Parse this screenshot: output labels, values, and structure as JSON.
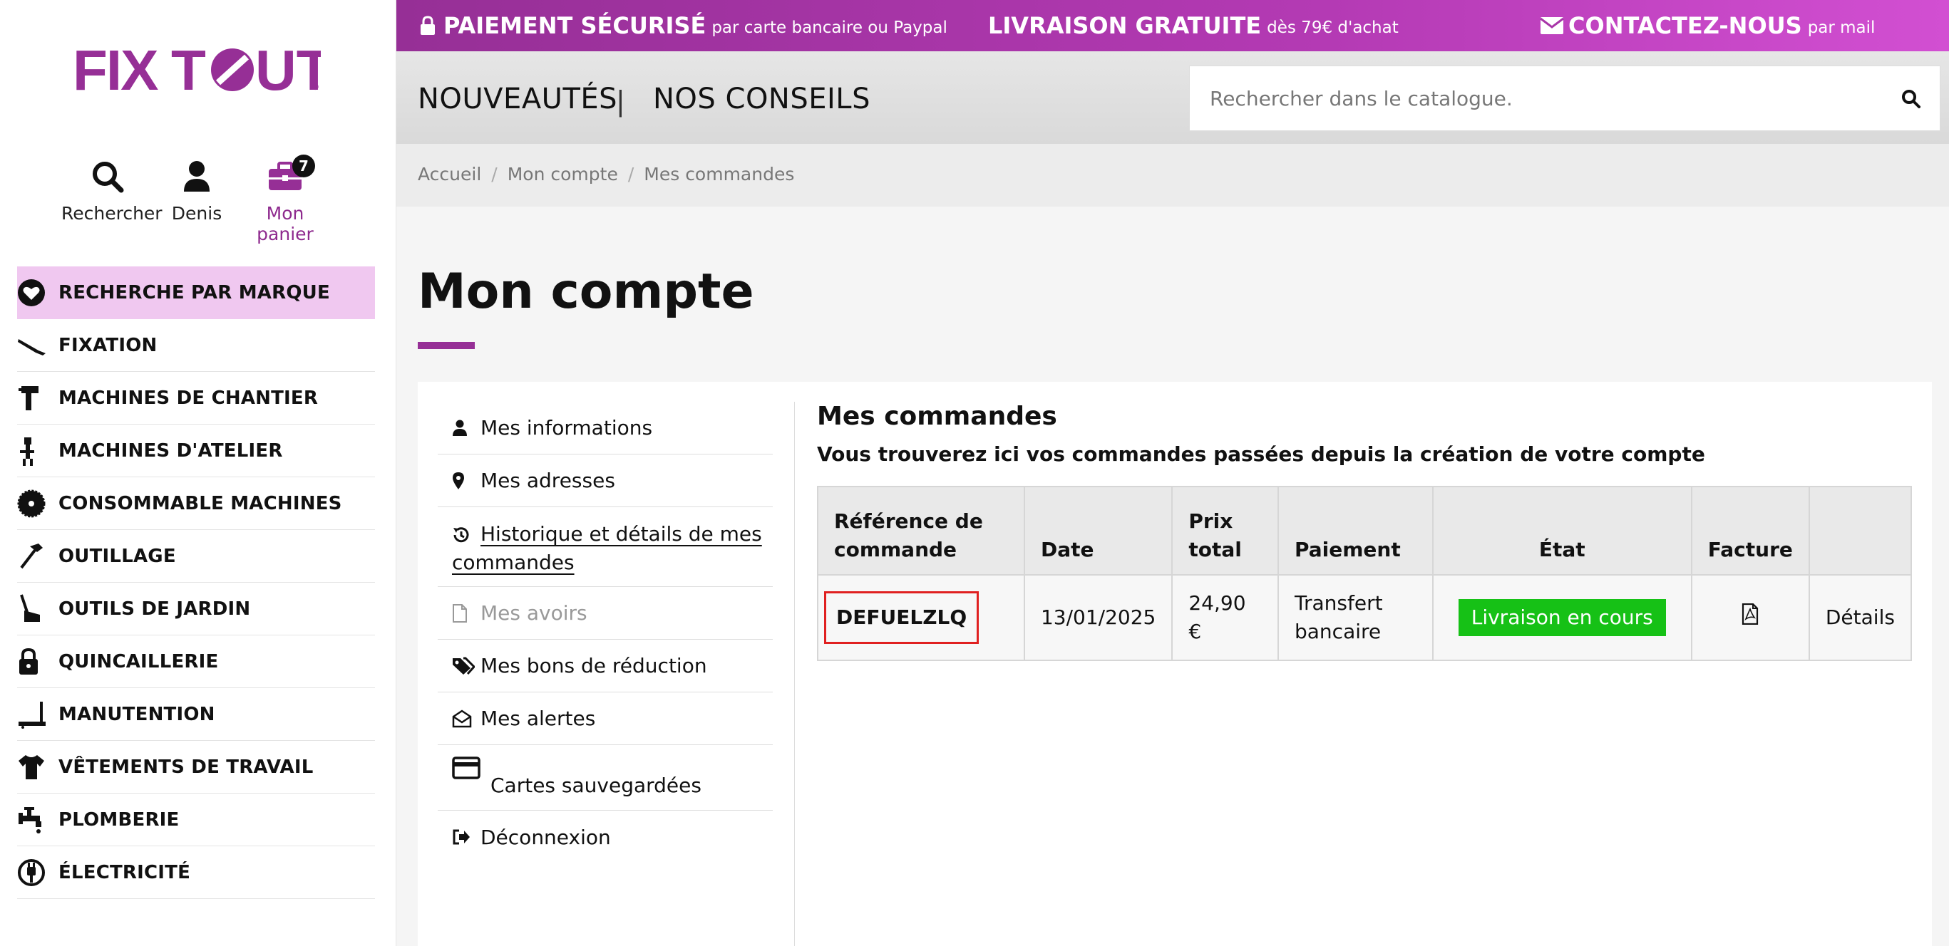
{
  "brand": {
    "logo_text": "FIXTOUT",
    "accent_color": "#962f96"
  },
  "header_icons": {
    "search_label": "Rechercher",
    "user_label": "Denis",
    "cart_label": "Mon panier",
    "cart_count": "7"
  },
  "sidebar_menu": [
    {
      "label": "RECHERCHE PAR MARQUE",
      "icon": "heart-icon"
    },
    {
      "label": "FIXATION",
      "icon": "nail-gun-icon"
    },
    {
      "label": "MACHINES DE CHANTIER",
      "icon": "drill-icon"
    },
    {
      "label": "MACHINES D'ATELIER",
      "icon": "bench-machine-icon"
    },
    {
      "label": "CONSOMMABLE MACHINES",
      "icon": "saw-blade-icon"
    },
    {
      "label": "OUTILLAGE",
      "icon": "hammer-icon"
    },
    {
      "label": "OUTILS DE JARDIN",
      "icon": "lawnmower-icon"
    },
    {
      "label": "QUINCAILLERIE",
      "icon": "padlock-icon"
    },
    {
      "label": "MANUTENTION",
      "icon": "pallet-jack-icon"
    },
    {
      "label": "VÊTEMENTS DE TRAVAIL",
      "icon": "tshirt-icon"
    },
    {
      "label": "PLOMBERIE",
      "icon": "faucet-icon"
    },
    {
      "label": "ÉLECTRICITÉ",
      "icon": "plug-icon"
    }
  ],
  "top_banner": {
    "secure_strong": "PAIEMENT SÉCURISÉ",
    "secure_small": "par carte bancaire ou Paypal",
    "delivery_strong": "LIVRAISON GRATUITE",
    "delivery_small": "dès 79€ d'achat",
    "contact_strong": "CONTACTEZ-NOUS",
    "contact_small": "par mail"
  },
  "nav": {
    "new_label": "NOUVEAUTÉS",
    "separator": "|",
    "tips_label": "NOS CONSEILS",
    "search_placeholder": "Rechercher dans le catalogue."
  },
  "breadcrumb": [
    "Accueil",
    "Mon compte",
    "Mes commandes"
  ],
  "page_title": "Mon compte",
  "account_nav": {
    "info": "Mes informations",
    "addresses": "Mes adresses",
    "history": "Historique et détails de mes commandes",
    "credits": "Mes avoirs",
    "vouchers": "Mes bons de réduction",
    "alerts": "Mes alertes",
    "cards": "Cartes sauvegardées",
    "logout": "Déconnexion"
  },
  "orders": {
    "title": "Mes commandes",
    "subtitle": "Vous trouverez ici vos commandes passées depuis la création de votre compte",
    "columns": {
      "reference_line1": "Référence de",
      "reference_line2": "commande",
      "date": "Date",
      "total_line1": "Prix",
      "total_line2": "total",
      "payment": "Paiement",
      "status": "État",
      "invoice": "Facture"
    },
    "rows": [
      {
        "reference": "DEFUELZLQ",
        "date": "13/01/2025",
        "total": "24,90 €",
        "payment_line1": "Transfert",
        "payment_line2": "bancaire",
        "status": "Livraison en cours",
        "status_color": "#16c116",
        "invoice_icon": "pdf-icon",
        "details": "Détails"
      }
    ]
  }
}
